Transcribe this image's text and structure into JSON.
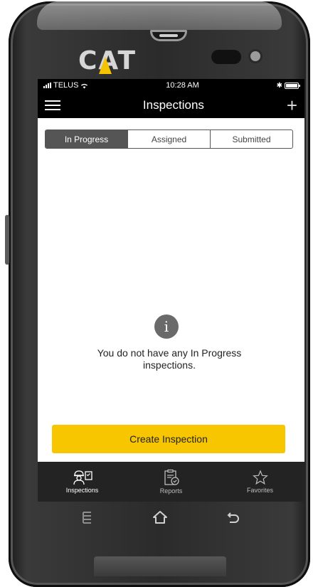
{
  "device": {
    "brand": "CAT"
  },
  "status_bar": {
    "carrier": "TELUS",
    "time": "10:28 AM"
  },
  "header": {
    "title": "Inspections",
    "add_icon": "plus-icon",
    "menu_icon": "hamburger-icon"
  },
  "segments": [
    {
      "label": "In Progress",
      "active": true
    },
    {
      "label": "Assigned",
      "active": false
    },
    {
      "label": "Submitted",
      "active": false
    }
  ],
  "empty_state": {
    "icon": "info-icon",
    "icon_glyph": "i",
    "line1": "You do not have any In Progress",
    "line2": "inspections."
  },
  "actions": {
    "create_label": "Create Inspection"
  },
  "tabbar": [
    {
      "label": "Inspections",
      "icon": "inspector-icon",
      "active": true
    },
    {
      "label": "Reports",
      "icon": "clipboard-check-icon",
      "active": false
    },
    {
      "label": "Favorites",
      "icon": "star-icon",
      "active": false
    }
  ],
  "colors": {
    "accent": "#f7c600",
    "tabbar_bg": "#232323",
    "segment_active": "#555555"
  }
}
